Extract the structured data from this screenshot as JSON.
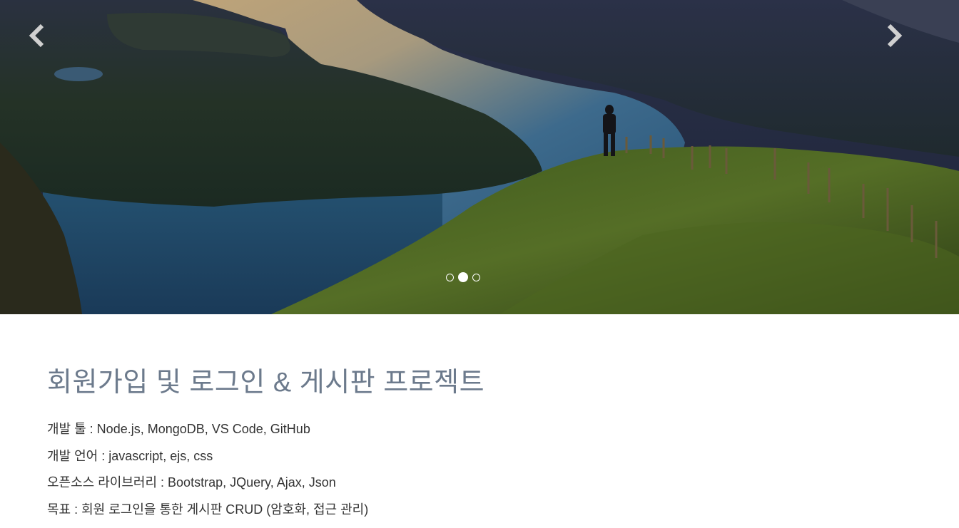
{
  "carousel": {
    "prev_icon": "chevron-left-icon",
    "next_icon": "chevron-right-icon",
    "slide_count": 3,
    "active_index": 1,
    "colors": {
      "arrow": "#d0d0d0",
      "indicator": "#ffffff"
    }
  },
  "project": {
    "title": "회원가입 및 로그인 & 게시판 프로젝트",
    "details": [
      "개발 툴 : Node.js, MongoDB, VS Code, GitHub",
      "개발 언어 : javascript, ejs, css",
      "오픈소스 라이브러리 : Bootstrap, JQuery, Ajax, Json",
      "목표 : 회원 로그인을 통한 게시판 CRUD (암호화, 접근 관리)"
    ],
    "title_color": "#6c7a8c",
    "text_color": "#333333"
  }
}
